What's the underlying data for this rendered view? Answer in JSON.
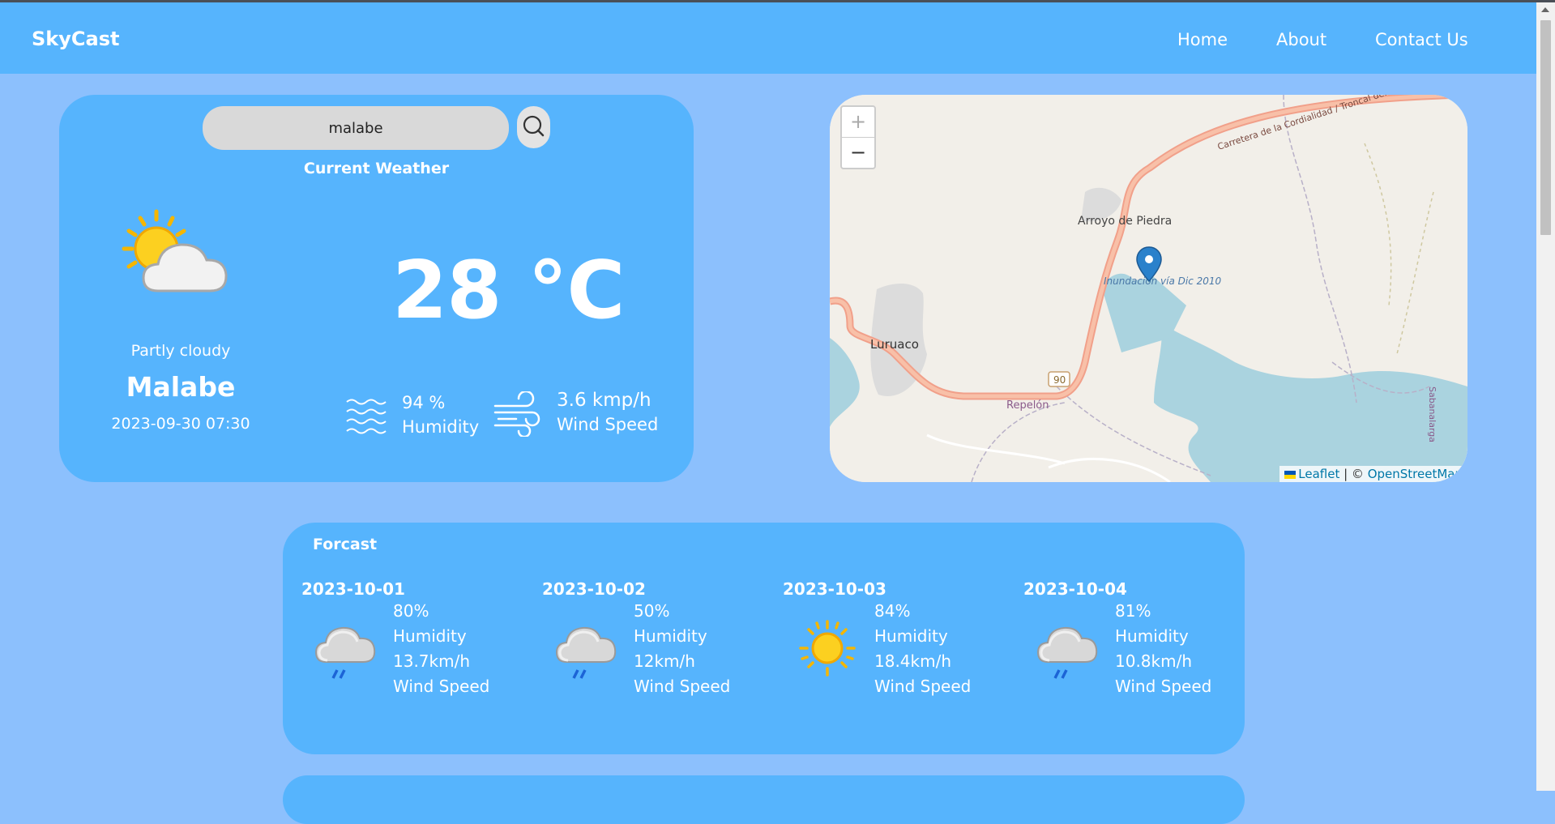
{
  "navbar": {
    "brand": "SkyCast",
    "links": [
      "Home",
      "About",
      "Contact Us"
    ]
  },
  "search": {
    "value": "malabe",
    "icon": "search-icon"
  },
  "current": {
    "title": "Current Weather",
    "condition": "Partly cloudy",
    "city": "Malabe",
    "datetime": "2023-09-30 07:30",
    "temperature": "28 °C",
    "humidity_value": "94 %",
    "humidity_label": "Humidity",
    "wind_value": "3.6 kmp/h",
    "wind_label": "Wind Speed",
    "icon": "partly-cloudy-icon"
  },
  "map": {
    "zoom_in": "+",
    "zoom_out": "−",
    "labels": [
      "Arroyo de Piedra",
      "Luruaco",
      "Repelón",
      "90",
      "Carretera de la Cordialidad / Troncal del Caribe",
      "Inundación vía Dic 2010",
      "Sabanalarga"
    ],
    "attribution_leaflet": "Leaflet",
    "attribution_sep": " | © ",
    "attribution_osm": "OpenStreetMap"
  },
  "forecast": {
    "title": "Forcast",
    "days": [
      {
        "date": "2023-10-01",
        "humidity": "80%",
        "humidity_label": "Humidity",
        "wind": "13.7km/h",
        "wind_label": "Wind Speed",
        "icon": "rain-cloud-icon"
      },
      {
        "date": "2023-10-02",
        "humidity": "50%",
        "humidity_label": "Humidity",
        "wind": "12km/h",
        "wind_label": "Wind Speed",
        "icon": "rain-cloud-icon"
      },
      {
        "date": "2023-10-03",
        "humidity": "84%",
        "humidity_label": "Humidity",
        "wind": "18.4km/h",
        "wind_label": "Wind Speed",
        "icon": "sun-icon"
      },
      {
        "date": "2023-10-04",
        "humidity": "81%",
        "humidity_label": "Humidity",
        "wind": "10.8km/h",
        "wind_label": "Wind Speed",
        "icon": "rain-cloud-icon"
      }
    ]
  },
  "colors": {
    "page_bg": "#8cc0fd",
    "card_bg": "#56b4fd",
    "text": "#ffffff"
  }
}
